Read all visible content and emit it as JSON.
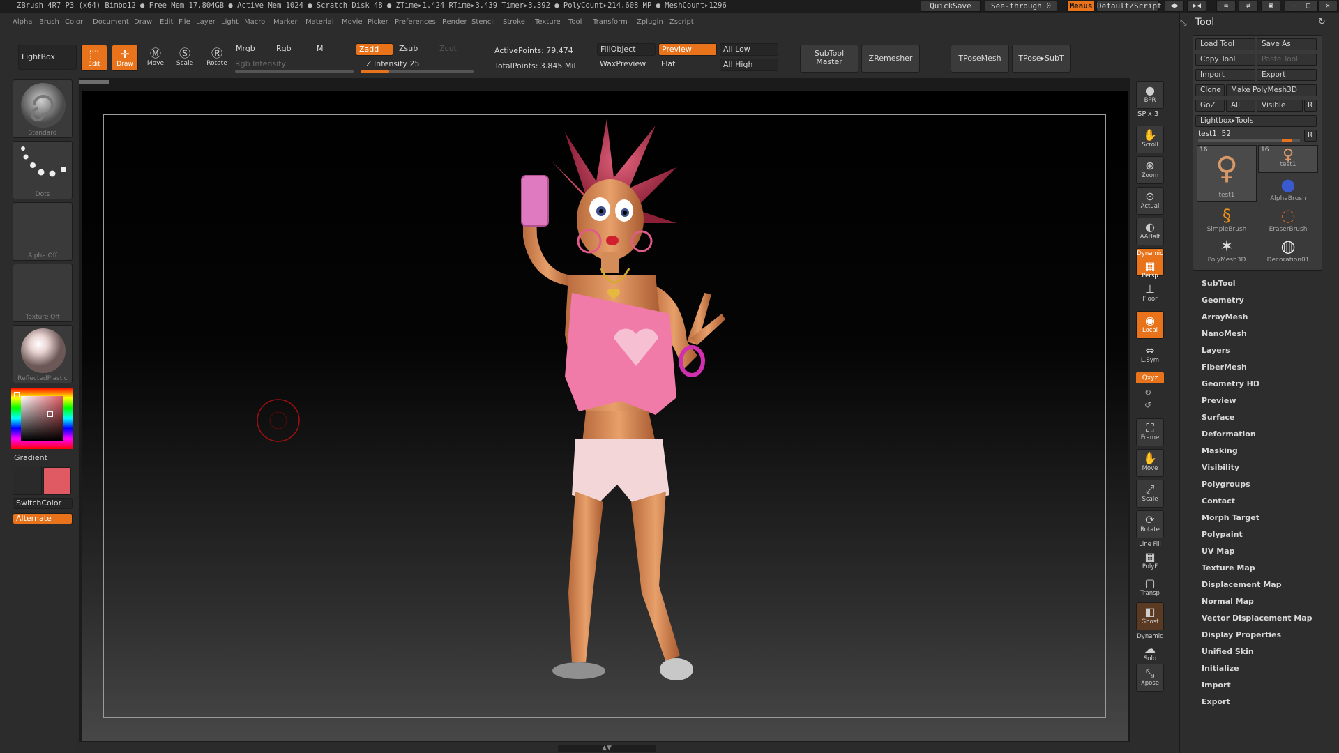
{
  "titlebar": {
    "info": "ZBrush 4R7 P3 (x64)   Bimbo12   ● Free Mem 17.804GB ● Active Mem 1024 ● Scratch Disk 48 ●  ZTime▸1.424 RTime▸3.439 Timer▸3.392 ● PolyCount▸214.608 MP  ● MeshCount▸1296",
    "quicksave": "QuickSave",
    "see_through": "See-through  0",
    "menus": "Menus",
    "default_zscript": "DefaultZScript"
  },
  "menubar": [
    "Alpha",
    "Brush",
    "Color",
    "Document",
    "Draw",
    "Edit",
    "File",
    "Layer",
    "Light",
    "Macro",
    "Marker",
    "Material",
    "Movie",
    "Picker",
    "Preferences",
    "Render",
    "Stencil",
    "Stroke",
    "Texture",
    "Tool",
    "Transform",
    "Zplugin",
    "Zscript"
  ],
  "toolbar": {
    "lightbox": "LightBox",
    "edit": "Edit",
    "draw": "Draw",
    "move": "Move",
    "scale": "Scale",
    "rotate": "Rotate",
    "mrgb": "Mrgb",
    "rgb": "Rgb",
    "m": "M",
    "rgb_intensity": "Rgb Intensity",
    "zadd": "Zadd",
    "zsub": "Zsub",
    "zcut": "Zcut",
    "z_intensity": "Z Intensity 25",
    "z_intensity_value": 0.25,
    "active_points": "ActivePoints: 79,474",
    "total_points": "TotalPoints: 3.845 Mil",
    "fill_object": "FillObject",
    "preview": "Preview",
    "all_low": "All Low",
    "wax_preview": "WaxPreview",
    "flat": "Flat",
    "all_high": "All High",
    "subtool_master_1": "SubTool",
    "subtool_master_2": "Master",
    "zremesher": "ZRemesher",
    "tpose_mesh": "TPoseMesh",
    "tpose_subt": "TPose▸SubT"
  },
  "leftshelf": {
    "brush": "Standard",
    "stroke": "Dots",
    "alpha": "Alpha Off",
    "texture": "Texture Off",
    "material": "ReflectedPlastic",
    "gradient": "Gradient",
    "switch_color": "SwitchColor",
    "alternate": "Alternate",
    "main_color": "#e05a63"
  },
  "rightshelf": {
    "bpr": "BPR",
    "spix": "SPix 3",
    "scroll": "Scroll",
    "zoom": "Zoom",
    "actual": "Actual",
    "aahalf": "AAHalf",
    "dynamic": "Dynamic",
    "persp": "Persp",
    "floor": "Floor",
    "local": "Local",
    "lsym": "L.Sym",
    "xyz": "Qxyz",
    "frame": "Frame",
    "move": "Move",
    "scale": "Scale",
    "rotate": "Rotate",
    "line_fill": "Line Fill",
    "polyf": "PolyF",
    "transp": "Transp",
    "ghost": "Ghost",
    "dynamic2": "Dynamic",
    "solo": "Solo",
    "xpose": "Xpose"
  },
  "toolpanel": {
    "title": "Tool",
    "load_tool": "Load Tool",
    "save_as": "Save As",
    "copy_tool": "Copy Tool",
    "paste_tool": "Paste Tool",
    "import": "Import",
    "export": "Export",
    "clone": "Clone",
    "make_polymesh": "Make PolyMesh3D",
    "goz": "GoZ",
    "all": "All",
    "visible": "Visible",
    "r": "R",
    "lightbox_tools": "Lightbox▸Tools",
    "current_tool": "test1. 52",
    "tiles": [
      {
        "name": "test1",
        "count": "16"
      },
      {
        "name": "test1",
        "count": "16"
      },
      {
        "name": "AlphaBrush"
      },
      {
        "name": "SimpleBrush"
      },
      {
        "name": "EraserBrush"
      },
      {
        "name": "PolyMesh3D"
      },
      {
        "name": "Decoration01"
      }
    ],
    "sections": [
      "SubTool",
      "Geometry",
      "ArrayMesh",
      "NanoMesh",
      "Layers",
      "FiberMesh",
      "Geometry HD",
      "Preview",
      "Surface",
      "Deformation",
      "Masking",
      "Visibility",
      "Polygroups",
      "Contact",
      "Morph Target",
      "Polypaint",
      "UV Map",
      "Texture Map",
      "Displacement Map",
      "Normal Map",
      "Vector Displacement Map",
      "Display Properties",
      "Unified Skin",
      "Initialize",
      "Import",
      "Export"
    ]
  }
}
